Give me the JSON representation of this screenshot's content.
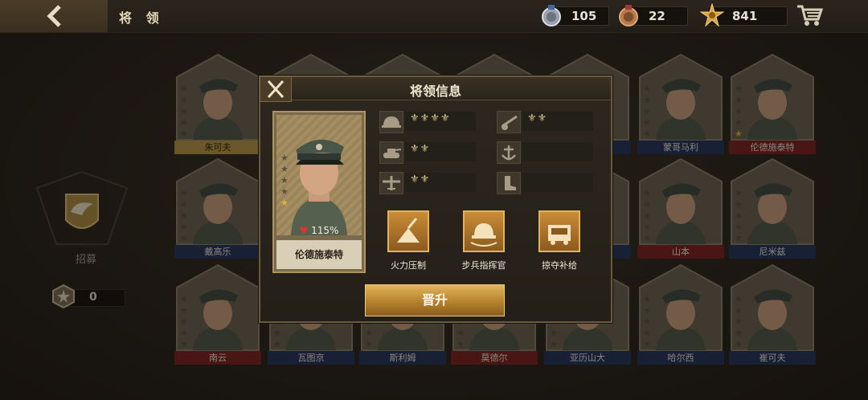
{
  "topbar": {
    "title": "将 领",
    "resources": [
      {
        "icon": "silver-medal-icon",
        "value": "105"
      },
      {
        "icon": "bronze-medal-icon",
        "value": "22"
      },
      {
        "icon": "gold-star-badge-icon",
        "value": "841"
      }
    ]
  },
  "left_panel": {
    "recruit_label": "招募",
    "token_count": "0"
  },
  "generals": [
    {
      "name": "朱可夫",
      "label_color": "gold",
      "stars": 0
    },
    {
      "name": "",
      "label_color": "blue",
      "stars": 0
    },
    {
      "name": "",
      "label_color": "blue",
      "stars": 0
    },
    {
      "name": "",
      "label_color": "blue",
      "stars": 0
    },
    {
      "name": "",
      "label_color": "blue",
      "stars": 0
    },
    {
      "name": "蒙哥马利",
      "label_color": "blue",
      "stars": 0
    },
    {
      "name": "伦德施泰特",
      "label_color": "red",
      "stars": 1
    },
    {
      "name": "戴高乐",
      "label_color": "blue",
      "stars": 0
    },
    {
      "name": "",
      "label_color": "blue",
      "stars": 0
    },
    {
      "name": "",
      "label_color": "blue",
      "stars": 0
    },
    {
      "name": "",
      "label_color": "blue",
      "stars": 0
    },
    {
      "name": "",
      "label_color": "blue",
      "stars": 0
    },
    {
      "name": "山本",
      "label_color": "red",
      "stars": 0
    },
    {
      "name": "尼米兹",
      "label_color": "blue",
      "stars": 0
    },
    {
      "name": "南云",
      "label_color": "red",
      "stars": 0
    },
    {
      "name": "瓦图京",
      "label_color": "blue",
      "stars": 0
    },
    {
      "name": "斯利姆",
      "label_color": "blue",
      "stars": 0
    },
    {
      "name": "莫德尔",
      "label_color": "red",
      "stars": 0
    },
    {
      "name": "亚历山大",
      "label_color": "blue",
      "stars": 0
    },
    {
      "name": "哈尔西",
      "label_color": "blue",
      "stars": 0
    },
    {
      "name": "崔可夫",
      "label_color": "blue",
      "stars": 0
    }
  ],
  "modal": {
    "title": "将领信息",
    "general_name": "伦德施泰特",
    "hp": "115%",
    "stars_filled": 1,
    "stats": [
      {
        "icon": "infantry-helmet-icon",
        "medals": "⚜⚜⚜⚜"
      },
      {
        "icon": "artillery-icon",
        "medals": "⚜⚜"
      },
      {
        "icon": "tank-icon",
        "medals": "⚜⚜"
      },
      {
        "icon": "navy-anchor-icon",
        "medals": ""
      },
      {
        "icon": "aircraft-icon",
        "medals": "⚜⚜"
      },
      {
        "icon": "boot-icon",
        "medals": ""
      }
    ],
    "skills": [
      {
        "icon": "fire-suppression-icon",
        "label": "火力压制"
      },
      {
        "icon": "infantry-commander-icon",
        "label": "步兵指挥官"
      },
      {
        "icon": "plunder-supply-icon",
        "label": "掠夺补给"
      }
    ],
    "promote_label": "晋升"
  }
}
